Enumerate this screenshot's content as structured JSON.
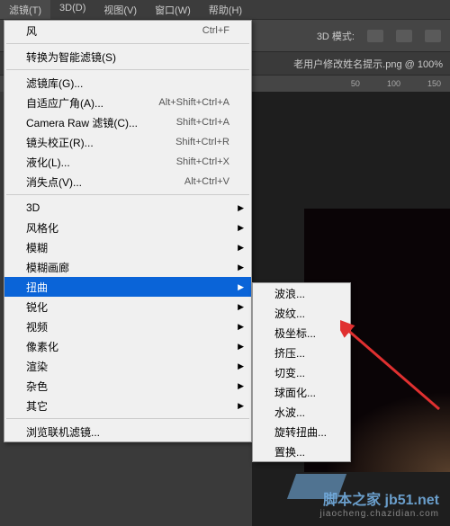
{
  "menubar": {
    "items": [
      {
        "label": "滤镜(T)"
      },
      {
        "label": "3D(D)"
      },
      {
        "label": "视图(V)"
      },
      {
        "label": "窗口(W)"
      },
      {
        "label": "帮助(H)"
      }
    ]
  },
  "toolbar": {
    "mode3d": "3D 模式:"
  },
  "tabbar": {
    "tab": "老用户修改姓名提示.png @ 100%"
  },
  "ruler": {
    "t0": "50",
    "t1": "100",
    "t2": "150"
  },
  "dropdown": {
    "recent": "风",
    "recentShortcut": "Ctrl+F",
    "convert": "转换为智能滤镜(S)",
    "filterGallery": "滤镜库(G)...",
    "adaptiveWide": "自适应广角(A)...",
    "adaptiveWideShortcut": "Alt+Shift+Ctrl+A",
    "cameraRaw": "Camera Raw 滤镜(C)...",
    "cameraRawShortcut": "Shift+Ctrl+A",
    "lensCorrect": "镜头校正(R)...",
    "lensCorrectShortcut": "Shift+Ctrl+R",
    "liquify": "液化(L)...",
    "liquifyShortcut": "Shift+Ctrl+X",
    "vanishing": "消失点(V)...",
    "vanishingShortcut": "Alt+Ctrl+V",
    "d3": "3D",
    "stylize": "风格化",
    "blur": "模糊",
    "blurGallery": "模糊画廊",
    "distort": "扭曲",
    "sharpen": "锐化",
    "video": "视频",
    "pixelate": "像素化",
    "render": "渲染",
    "noise": "杂色",
    "other": "其它",
    "browse": "浏览联机滤镜..."
  },
  "submenu": {
    "wave": "波浪...",
    "ripple": "波纹...",
    "polar": "极坐标...",
    "pinch": "挤压...",
    "shear": "切变...",
    "spherize": "球面化...",
    "zigzag": "水波...",
    "twirl": "旋转扭曲...",
    "displace": "置换..."
  },
  "watermark": {
    "line1": "脚本之家 jb51.net",
    "line2": "jiaocheng.chazidian.com"
  }
}
